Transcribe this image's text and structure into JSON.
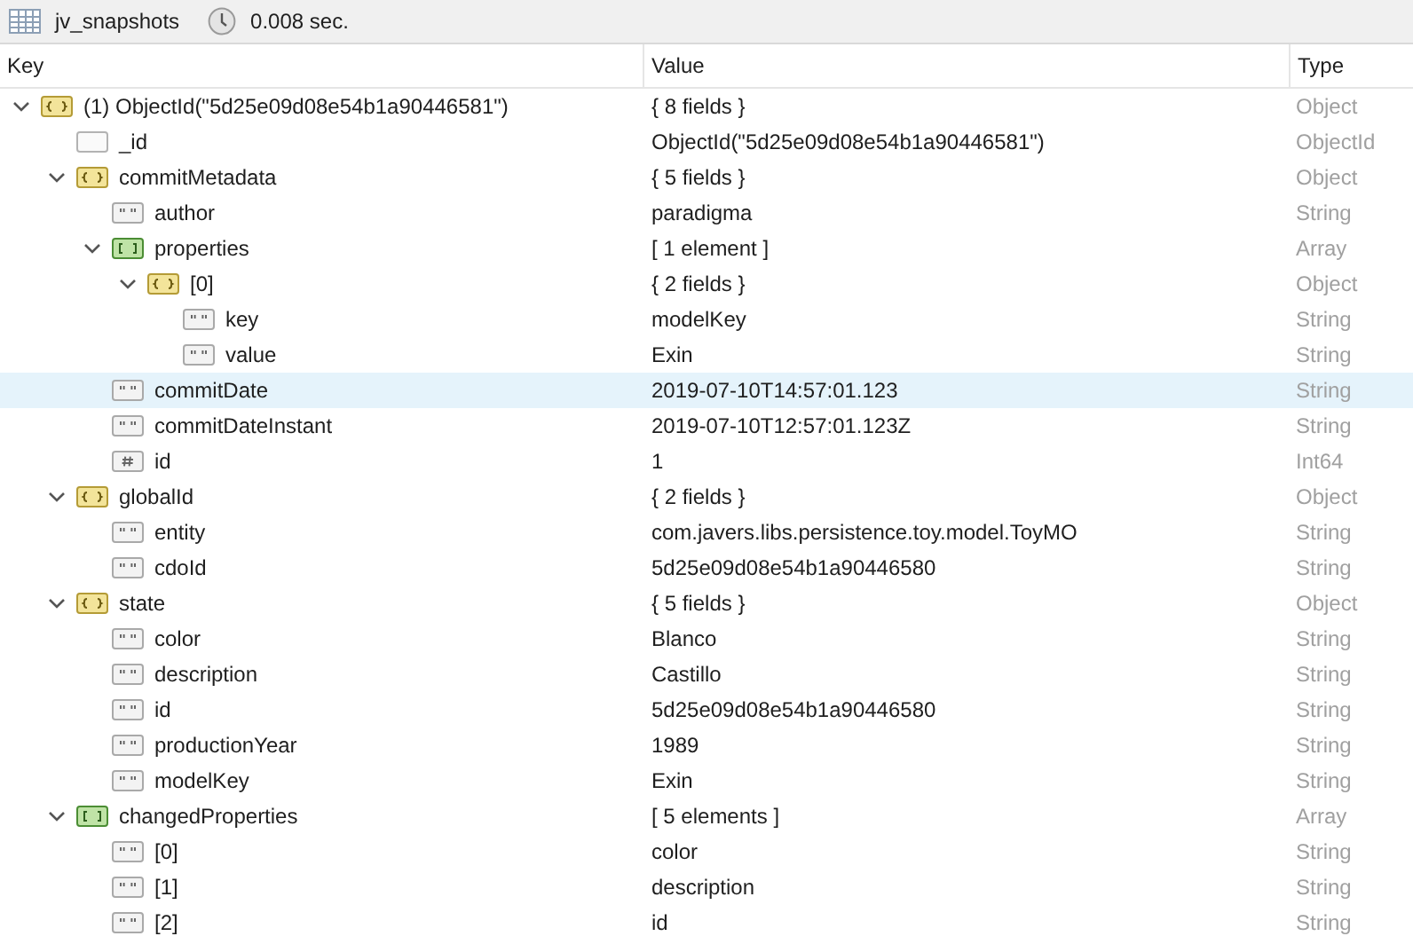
{
  "toolbar": {
    "collection": "jv_snapshots",
    "duration": "0.008 sec."
  },
  "columns": [
    "Key",
    "Value",
    "Type"
  ],
  "rows": [
    {
      "key": "(1) ObjectId(\"5d25e09d08e54b1a90446581\")",
      "value": "{ 8 fields }",
      "type": "Object",
      "kind": "object",
      "expanded": true,
      "selected": false,
      "children": [
        {
          "key": "_id",
          "value": "ObjectId(\"5d25e09d08e54b1a90446581\")",
          "type": "ObjectId",
          "kind": "objectid",
          "selected": false
        },
        {
          "key": "commitMetadata",
          "value": "{ 5 fields }",
          "type": "Object",
          "kind": "object",
          "expanded": true,
          "selected": false,
          "children": [
            {
              "key": "author",
              "value": "paradigma",
              "type": "String",
              "kind": "string",
              "selected": false
            },
            {
              "key": "properties",
              "value": "[ 1 element ]",
              "type": "Array",
              "kind": "array",
              "expanded": true,
              "selected": false,
              "children": [
                {
                  "key": "[0]",
                  "value": "{ 2 fields }",
                  "type": "Object",
                  "kind": "object",
                  "expanded": true,
                  "selected": false,
                  "children": [
                    {
                      "key": "key",
                      "value": "modelKey",
                      "type": "String",
                      "kind": "string",
                      "selected": false
                    },
                    {
                      "key": "value",
                      "value": "Exin",
                      "type": "String",
                      "kind": "string",
                      "selected": false
                    }
                  ]
                }
              ]
            },
            {
              "key": "commitDate",
              "value": "2019-07-10T14:57:01.123",
              "type": "String",
              "kind": "string",
              "selected": true
            },
            {
              "key": "commitDateInstant",
              "value": "2019-07-10T12:57:01.123Z",
              "type": "String",
              "kind": "string",
              "selected": false
            },
            {
              "key": "id",
              "value": "1",
              "type": "Int64",
              "kind": "int",
              "selected": false
            }
          ]
        },
        {
          "key": "globalId",
          "value": "{ 2 fields }",
          "type": "Object",
          "kind": "object",
          "expanded": true,
          "selected": false,
          "children": [
            {
              "key": "entity",
              "value": "com.javers.libs.persistence.toy.model.ToyMO",
              "type": "String",
              "kind": "string",
              "selected": false
            },
            {
              "key": "cdoId",
              "value": "5d25e09d08e54b1a90446580",
              "type": "String",
              "kind": "string",
              "selected": false
            }
          ]
        },
        {
          "key": "state",
          "value": "{ 5 fields }",
          "type": "Object",
          "kind": "object",
          "expanded": true,
          "selected": false,
          "children": [
            {
              "key": "color",
              "value": "Blanco",
              "type": "String",
              "kind": "string",
              "selected": false
            },
            {
              "key": "description",
              "value": "Castillo",
              "type": "String",
              "kind": "string",
              "selected": false
            },
            {
              "key": "id",
              "value": "5d25e09d08e54b1a90446580",
              "type": "String",
              "kind": "string",
              "selected": false
            },
            {
              "key": "productionYear",
              "value": "1989",
              "type": "String",
              "kind": "string",
              "selected": false
            },
            {
              "key": "modelKey",
              "value": "Exin",
              "type": "String",
              "kind": "string",
              "selected": false
            }
          ]
        },
        {
          "key": "changedProperties",
          "value": "[ 5 elements ]",
          "type": "Array",
          "kind": "array",
          "expanded": true,
          "selected": false,
          "children": [
            {
              "key": "[0]",
              "value": "color",
              "type": "String",
              "kind": "string",
              "selected": false
            },
            {
              "key": "[1]",
              "value": "description",
              "type": "String",
              "kind": "string",
              "selected": false
            },
            {
              "key": "[2]",
              "value": "id",
              "type": "String",
              "kind": "string",
              "selected": false
            }
          ]
        }
      ]
    }
  ]
}
